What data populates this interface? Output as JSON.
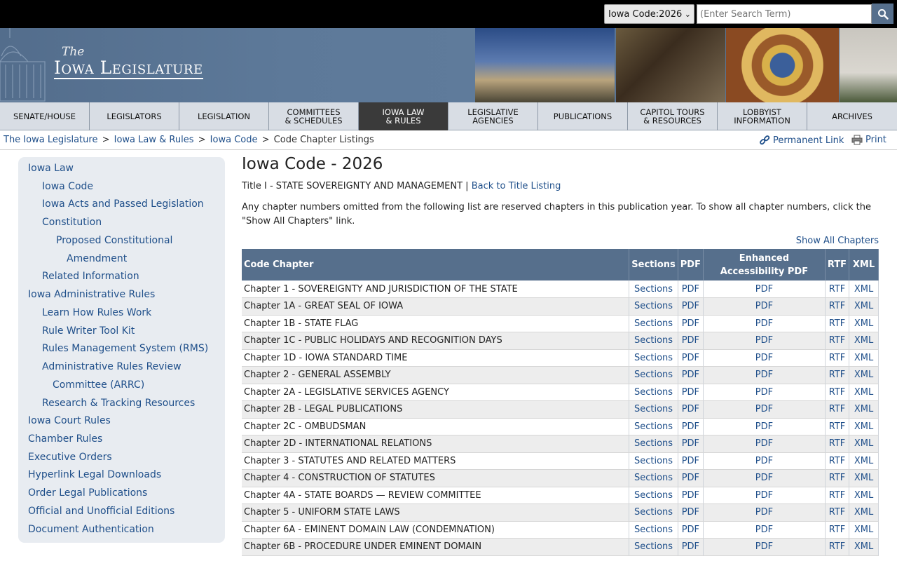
{
  "search": {
    "scope": "Iowa Code:2026",
    "placeholder": "(Enter Search Term)"
  },
  "logo": {
    "the": "The",
    "name": "Iowa Legislature"
  },
  "nav": [
    "SENATE/HOUSE",
    "LEGISLATORS",
    "LEGISLATION",
    "COMMITTEES\n& SCHEDULES",
    "IOWA LAW\n& RULES",
    "LEGISLATIVE\nAGENCIES",
    "PUBLICATIONS",
    "CAPITOL TOURS\n& RESOURCES",
    "LOBBYIST\nINFORMATION",
    "ARCHIVES"
  ],
  "breadcrumb": {
    "items": [
      "The Iowa Legislature",
      "Iowa Law & Rules",
      "Iowa Code"
    ],
    "current": "Code Chapter Listings",
    "sep": ">"
  },
  "tools": {
    "permanent_link": "Permanent Link",
    "print": "Print"
  },
  "sidebar": [
    "Iowa Law",
    "Iowa Code",
    "Iowa Acts and Passed Legislation",
    "Constitution",
    "Proposed Constitutional",
    "Amendment",
    "Related Information",
    "Iowa Administrative Rules",
    "Learn How Rules Work",
    "Rule Writer Tool Kit",
    "Rules Management System (RMS)",
    "Administrative Rules Review",
    "Committee (ARRC)",
    "Research & Tracking Resources",
    "Iowa Court Rules",
    "Chamber Rules",
    "Executive Orders",
    "Hyperlink Legal Downloads",
    "Order Legal Publications",
    "Official and Unofficial Editions",
    "Document Authentication"
  ],
  "main": {
    "title": "Iowa Code - 2026",
    "title_line": "Title I - STATE SOVEREIGNTY AND MANAGEMENT |",
    "back_link": "Back to Title Listing",
    "intro": "Any chapter numbers omitted from the following list are reserved chapters in this publication year. To show all chapter numbers, click the \"Show All Chapters\" link.",
    "show_all": "Show All Chapters"
  },
  "table": {
    "headers": [
      "Code Chapter",
      "Sections",
      "PDF",
      "Enhanced Accessibility PDF",
      "RTF",
      "XML"
    ],
    "link_labels": [
      "Sections",
      "PDF",
      "PDF",
      "RTF",
      "XML"
    ],
    "rows": [
      "Chapter 1 - SOVEREIGNTY AND JURISDICTION OF THE STATE",
      "Chapter 1A - GREAT SEAL OF IOWA",
      "Chapter 1B - STATE FLAG",
      "Chapter 1C - PUBLIC HOLIDAYS AND RECOGNITION DAYS",
      "Chapter 1D - IOWA STANDARD TIME",
      "Chapter 2 - GENERAL ASSEMBLY",
      "Chapter 2A - LEGISLATIVE SERVICES AGENCY",
      "Chapter 2B - LEGAL PUBLICATIONS",
      "Chapter 2C - OMBUDSMAN",
      "Chapter 2D - INTERNATIONAL RELATIONS",
      "Chapter 3 - STATUTES AND RELATED MATTERS",
      "Chapter 4 - CONSTRUCTION OF STATUTES",
      "Chapter 4A - STATE BOARDS — REVIEW COMMITTEE",
      "Chapter 5 - UNIFORM STATE LAWS",
      "Chapter 6A - EMINENT DOMAIN LAW (CONDEMNATION)",
      "Chapter 6B - PROCEDURE UNDER EMINENT DOMAIN"
    ]
  }
}
